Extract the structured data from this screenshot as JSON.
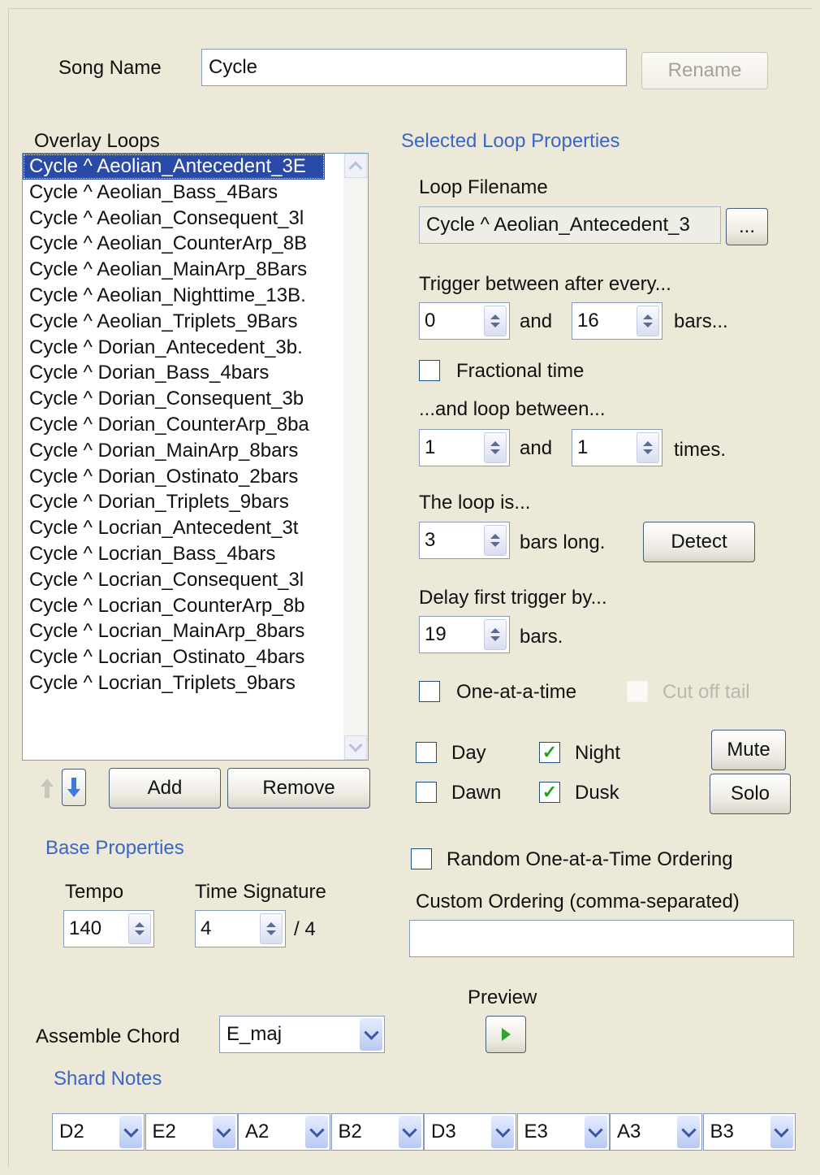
{
  "song": {
    "label": "Song Name",
    "value": "Cycle",
    "rename": "Rename"
  },
  "overlay": {
    "title": "Overlay Loops",
    "items": [
      "Cycle ^ Aeolian_Antecedent_3E",
      "Cycle ^ Aeolian_Bass_4Bars",
      "Cycle ^ Aeolian_Consequent_3l",
      "Cycle ^ Aeolian_CounterArp_8B",
      "Cycle ^ Aeolian_MainArp_8Bars",
      "Cycle ^ Aeolian_Nighttime_13B.",
      "Cycle ^ Aeolian_Triplets_9Bars",
      "Cycle ^ Dorian_Antecedent_3b.",
      "Cycle ^ Dorian_Bass_4bars",
      "Cycle ^ Dorian_Consequent_3b",
      "Cycle ^ Dorian_CounterArp_8ba",
      "Cycle ^ Dorian_MainArp_8bars",
      "Cycle ^ Dorian_Ostinato_2bars",
      "Cycle ^ Dorian_Triplets_9bars",
      "Cycle ^ Locrian_Antecedent_3t",
      "Cycle ^ Locrian_Bass_4bars",
      "Cycle ^ Locrian_Consequent_3l",
      "Cycle ^ Locrian_CounterArp_8b",
      "Cycle ^ Locrian_MainArp_8bars",
      "Cycle ^ Locrian_Ostinato_4bars",
      "Cycle ^ Locrian_Triplets_9bars"
    ],
    "add": "Add",
    "remove": "Remove"
  },
  "props": {
    "title": "Selected Loop Properties",
    "filename_label": "Loop Filename",
    "filename": "Cycle ^ Aeolian_Antecedent_3",
    "browse": "...",
    "trigger_label": "Trigger between after every...",
    "trigger_min": "0",
    "trigger_max": "16",
    "and": "and",
    "bars_dots": "bars...",
    "fractional": "Fractional time",
    "loop_between": "...and loop between...",
    "loop_min": "1",
    "loop_max": "1",
    "times": "times.",
    "loop_is": "The loop is...",
    "loop_len": "3",
    "bars_long": "bars long.",
    "detect": "Detect",
    "delay_label": "Delay first trigger by...",
    "delay": "19",
    "bars": "bars.",
    "one_at_a_time": "One-at-a-time",
    "cut_off_tail": "Cut off tail",
    "day": "Day",
    "night": "Night",
    "dawn": "Dawn",
    "dusk": "Dusk",
    "mute": "Mute",
    "solo": "Solo",
    "random_order": "Random One-at-a-Time Ordering",
    "custom_label": "Custom Ordering (comma-separated)",
    "custom_value": ""
  },
  "base": {
    "title": "Base Properties",
    "tempo_label": "Tempo",
    "tempo": "140",
    "ts_label": "Time Signature",
    "ts": "4",
    "ts_denom": "/ 4"
  },
  "preview": {
    "label": "Preview"
  },
  "chord": {
    "label": "Assemble Chord",
    "value": "E_maj"
  },
  "shard": {
    "title": "Shard Notes",
    "notes": [
      "D2",
      "E2",
      "A2",
      "B2",
      "D3",
      "E3",
      "A3",
      "B3"
    ]
  },
  "checkmark": "✓"
}
